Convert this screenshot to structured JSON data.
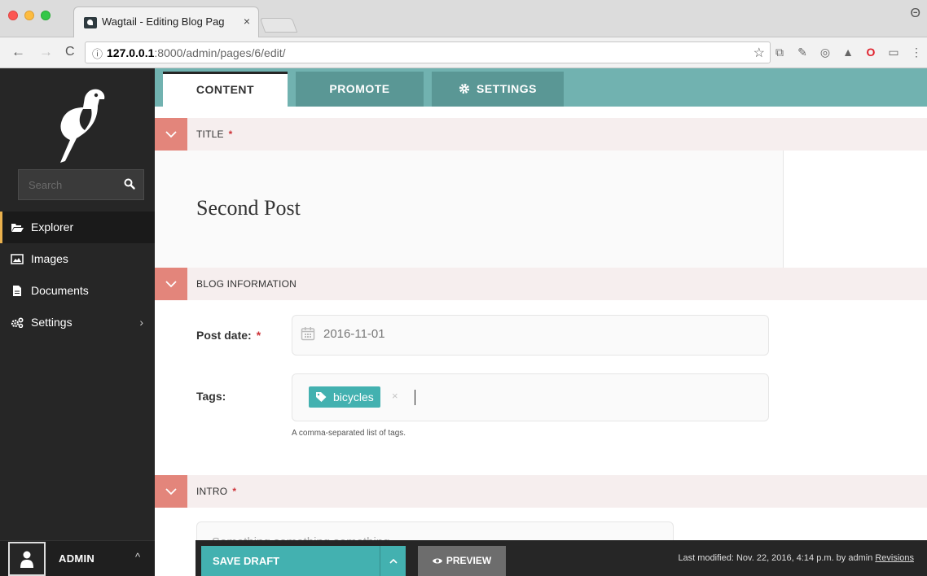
{
  "browser": {
    "tab_title": "Wagtail - Editing Blog Page: Se",
    "tab_close": "×",
    "url_host": "127.0.0.1",
    "url_rest": ":8000/admin/pages/6/edit/",
    "back_glyph": "←",
    "forward_glyph": "→",
    "reload_glyph": "C",
    "info_glyph": "ⓘ",
    "star_glyph": "☆",
    "profile_glyph": "Θ"
  },
  "sidebar": {
    "search_placeholder": "Search",
    "items": [
      {
        "label": "Explorer",
        "icon": "folder-open-icon"
      },
      {
        "label": "Images",
        "icon": "image-icon"
      },
      {
        "label": "Documents",
        "icon": "document-icon"
      },
      {
        "label": "Settings",
        "icon": "cogs-icon"
      }
    ],
    "settings_chevron": "›",
    "user": {
      "name": "ADMIN",
      "chevron": "^"
    }
  },
  "tabs": {
    "content": "CONTENT",
    "promote": "PROMOTE",
    "settings": "SETTINGS"
  },
  "sections": {
    "title": {
      "label": "TITLE",
      "required": "*",
      "value": "Second Post"
    },
    "blog_information": {
      "label": "BLOG INFORMATION"
    },
    "intro": {
      "label": "INTRO",
      "required": "*",
      "value": "Something something something..."
    }
  },
  "fields": {
    "post_date": {
      "label": "Post date:",
      "required": "*",
      "value": "2016-11-01"
    },
    "tags": {
      "label": "Tags:",
      "values": [
        "bicycles"
      ],
      "remove": "×",
      "help": "A comma-separated list of tags."
    }
  },
  "footer": {
    "save_draft": "SAVE DRAFT",
    "preview": "PREVIEW",
    "last_modified": "Last modified: Nov. 22, 2016, 4:14 p.m. by admin",
    "revisions": "Revisions"
  },
  "colors": {
    "teal_header": "#71b2b0",
    "teal_button": "#43b1b0",
    "salmon_toggle": "#e3857b",
    "section_bg": "#f6eeee",
    "sidebar_bg": "#262626",
    "required_red": "#cd3238"
  }
}
